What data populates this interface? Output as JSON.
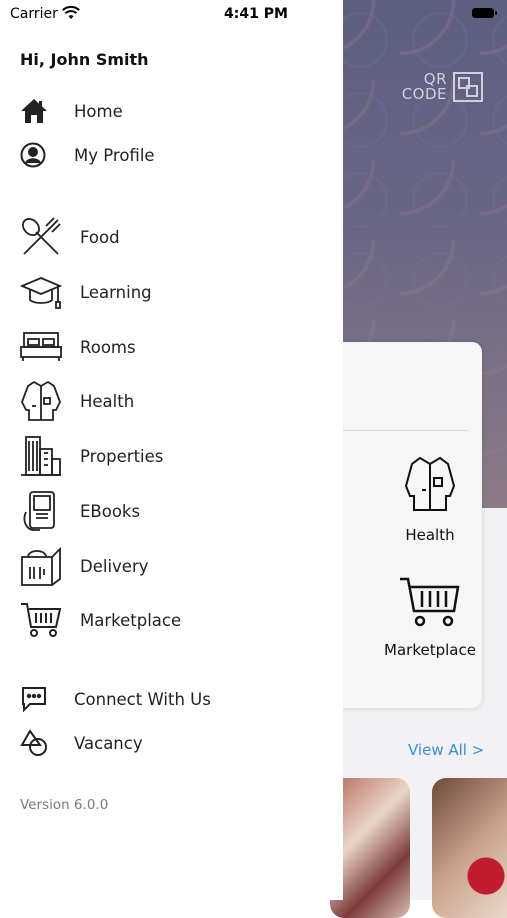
{
  "status_bar": {
    "carrier": "Carrier",
    "time": "4:41 PM"
  },
  "drawer": {
    "greeting": "Hi, John Smith",
    "top_items": [
      {
        "label": "Home",
        "icon": "home-icon"
      },
      {
        "label": "My Profile",
        "icon": "profile-icon"
      }
    ],
    "service_items": [
      {
        "label": "Food",
        "icon": "food-icon"
      },
      {
        "label": "Learning",
        "icon": "graduation-cap-icon"
      },
      {
        "label": "Rooms",
        "icon": "bed-icon"
      },
      {
        "label": "Health",
        "icon": "health-coat-icon"
      },
      {
        "label": "Properties",
        "icon": "buildings-icon"
      },
      {
        "label": "EBooks",
        "icon": "ebook-icon"
      },
      {
        "label": "Delivery",
        "icon": "delivery-bag-icon"
      },
      {
        "label": "Marketplace",
        "icon": "cart-icon"
      }
    ],
    "bottom_items": [
      {
        "label": "Connect With Us",
        "icon": "chat-icon"
      },
      {
        "label": "Vacancy",
        "icon": "shapes-icon"
      }
    ],
    "version": "Version 6.0.0"
  },
  "background": {
    "qr": {
      "line1": "QR",
      "line2": "CODE"
    },
    "card_items": [
      {
        "label": "Health",
        "icon": "health-coat-icon"
      },
      {
        "label": "Marketplace",
        "icon": "cart-icon"
      }
    ],
    "view_all": "View All >"
  },
  "colors": {
    "link": "#3b8fd1",
    "text": "#222222",
    "muted": "#7a7a7a"
  }
}
